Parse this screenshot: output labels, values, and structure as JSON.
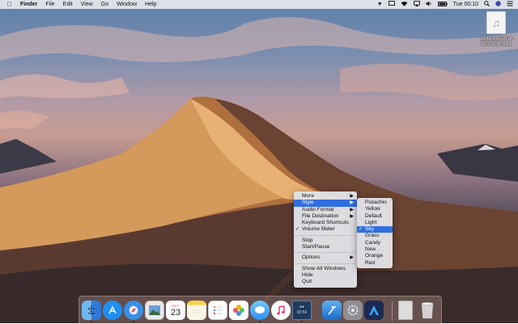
{
  "menubar": {
    "app_name": "Finder",
    "items": [
      "File",
      "Edit",
      "View",
      "Go",
      "Window",
      "Help"
    ],
    "clock": "Tue 00:10",
    "status_icons": [
      "shield-icon",
      "cast-icon",
      "wifi-icon",
      "airplay-icon",
      "volume-icon",
      "battery-icon",
      "search-icon",
      "siri-icon",
      "list-icon"
    ]
  },
  "desktop_file": {
    "name": "23 Oct 2018 at 00/09/04.m4a",
    "line1": "23 Oct 2018 at",
    "line2": "00/09/04.m4a",
    "icon": "music-note-icon"
  },
  "context_menu": {
    "items": [
      {
        "label": "More",
        "submenu": true
      },
      {
        "label": "Style",
        "submenu": true,
        "selected": true
      },
      {
        "label": "Audio Format",
        "submenu": true
      },
      {
        "label": "File Destination",
        "submenu": true
      },
      {
        "label": "Keyboard Shortcuts"
      },
      {
        "label": "Volume Meter",
        "checked": true
      },
      {
        "label": "Stop"
      },
      {
        "label": "Start/Pause"
      },
      {
        "label": "Options",
        "submenu": true
      },
      {
        "label": "Show All Windows"
      },
      {
        "label": "Hide"
      },
      {
        "label": "Quit"
      }
    ]
  },
  "style_submenu": {
    "items": [
      "Pistachio",
      "Yellow",
      "Default",
      "Light",
      "Sky",
      "Grass",
      "Candy",
      "New",
      "Orange",
      "Red"
    ],
    "checked": "Sky"
  },
  "dock": {
    "calendar_month": "OCT",
    "calendar_day": "23",
    "recorder_time": "00:56",
    "apps": [
      "finder-icon",
      "app-store-icon",
      "safari-icon",
      "preview-icon",
      "calendar-icon",
      "notes-icon",
      "reminders-icon",
      "photos-icon",
      "messages-icon",
      "itunes-icon",
      "recorder-icon",
      "xcode-icon",
      "system-preferences-icon",
      "affinity-designer-icon",
      "document-icon",
      "trash-icon"
    ]
  },
  "colors": {
    "selection": "#2f6ee0",
    "menubar_bg": "#e8e8ec"
  }
}
